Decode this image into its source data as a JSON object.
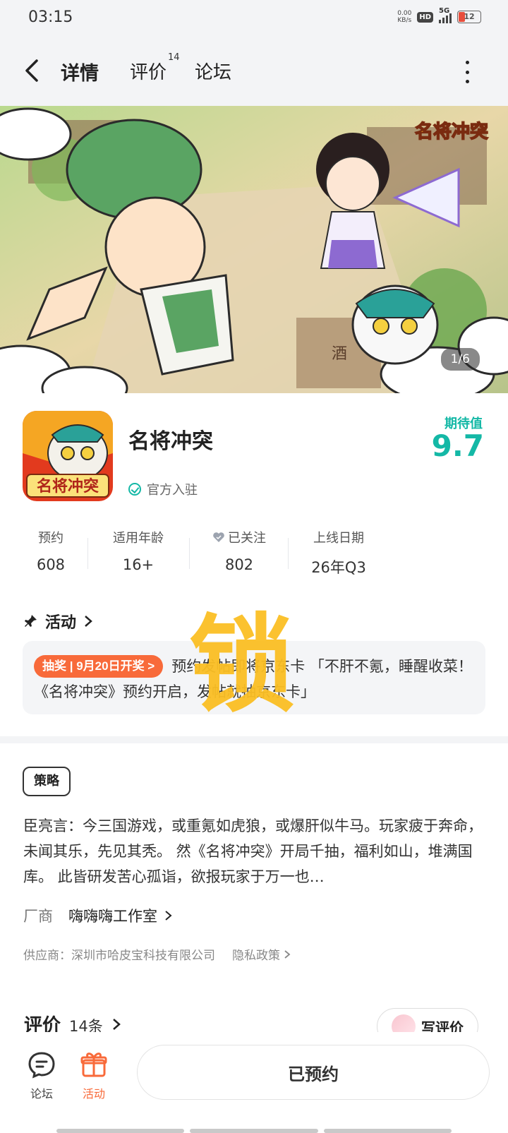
{
  "status_bar": {
    "time": "03:15",
    "net_speed_top": "0.00",
    "net_speed_bottom": "KB/s",
    "hd": "HD",
    "network": "5G",
    "battery": "12"
  },
  "header": {
    "tabs": [
      {
        "label": "详情",
        "active": true
      },
      {
        "label": "评价",
        "badge": "14"
      },
      {
        "label": "论坛"
      }
    ]
  },
  "banner": {
    "counter": "1/6",
    "logo_text": "名将冲突",
    "sign_text": "酒"
  },
  "app": {
    "name": "名将冲突",
    "icon_text": "名将冲突",
    "official_label": "官方入驻",
    "expect_label": "期待值",
    "expect_value": "9.7"
  },
  "stats": [
    {
      "label": "预约",
      "value": "608"
    },
    {
      "label": "适用年龄",
      "value": "16+"
    },
    {
      "label": "已关注",
      "value": "802"
    },
    {
      "label": "上线日期",
      "value": "26年Q3"
    }
  ],
  "activity": {
    "title": "活动",
    "tag": "抽奖 | 9月20日开奖 >",
    "text": "预约发帖即将京东卡 「不肝不氪，睡醒收菜！《名将冲突》预约开启，发帖就抽京东卡」",
    "watermark": "锁"
  },
  "strategy": {
    "tag": "策略",
    "text": "臣亮言：今三国游戏，或重氪如虎狼，或爆肝似牛马。玩家疲于奔命，未闻其乐，先见其秃。 然《名将冲突》开局千抽，福利如山，堆满国库。 此皆研发苦心孤诣，欲报玩家于万一也…"
  },
  "vendor": {
    "label": "厂商",
    "name": "嗨嗨嗨工作室"
  },
  "supplier": {
    "text": "供应商：深圳市哈皮宝科技有限公司",
    "privacy": "隐私政策"
  },
  "reviews": {
    "title": "评价",
    "count": "14条",
    "write_label": "写评价"
  },
  "bottom_bar": {
    "forum_label": "论坛",
    "activity_label": "活动",
    "reserved_label": "已预约"
  },
  "colors": {
    "accent": "#14b8a6",
    "tab_underline": "#2dd4bf",
    "lottery": "#f86a3a",
    "watermark": "#fbbf24"
  }
}
